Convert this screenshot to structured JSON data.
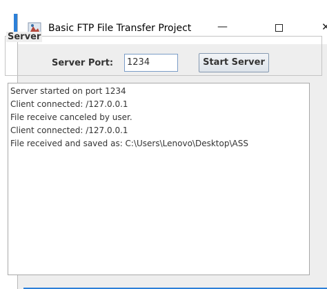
{
  "window": {
    "title": "Basic FTP File Transfer Project",
    "minimize_label": "—",
    "close_label": "✕"
  },
  "server_group": {
    "title": "Server",
    "port_label": "Server Port:",
    "port_value": "1234",
    "start_button_label": "Start Server"
  },
  "log": [
    "Server started on port 1234",
    "Client connected: /127.0.0.1",
    "File receive canceled by user.",
    "Client connected: /127.0.0.1",
    "File received and saved as: C:\\Users\\Lenovo\\Desktop\\ASS"
  ],
  "colors": {
    "accent": "#2c80d8",
    "window_bg": "#eeeeee"
  }
}
